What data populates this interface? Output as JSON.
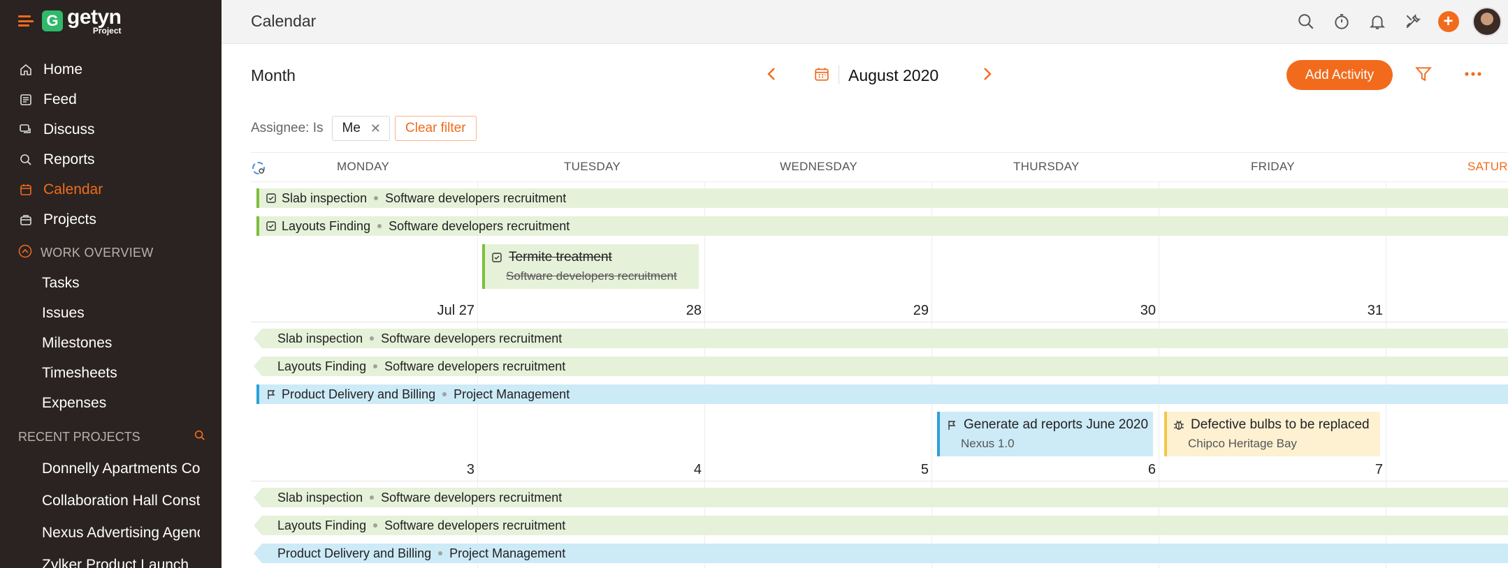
{
  "app": {
    "brand_name": "getyn",
    "brand_sub": "Project",
    "page_title": "Calendar"
  },
  "sidebar": {
    "nav": [
      {
        "label": "Home",
        "icon": "home-icon"
      },
      {
        "label": "Feed",
        "icon": "feed-icon"
      },
      {
        "label": "Discuss",
        "icon": "discuss-icon"
      },
      {
        "label": "Reports",
        "icon": "reports-icon"
      },
      {
        "label": "Calendar",
        "icon": "calendar-icon",
        "active": true
      },
      {
        "label": "Projects",
        "icon": "projects-icon"
      }
    ],
    "work_overview_label": "WORK OVERVIEW",
    "work_overview_items": [
      "Tasks",
      "Issues",
      "Milestones",
      "Timesheets",
      "Expenses"
    ],
    "recent_projects_label": "RECENT PROJECTS",
    "recent_projects": [
      "Donnelly Apartments Construction",
      "Collaboration Hall Construction",
      "Nexus Advertising Agency",
      "Zylker Product Launch"
    ]
  },
  "toolbar": {
    "view_label": "Month",
    "month_label": "August 2020",
    "add_activity_label": "Add Activity"
  },
  "filter": {
    "label": "Assignee: Is",
    "chip_value": "Me",
    "chip_remove": "✕",
    "clear_label": "Clear filter"
  },
  "calendar": {
    "weekdays": [
      "MONDAY",
      "TUESDAY",
      "WEDNESDAY",
      "THURSDAY",
      "FRIDAY",
      "SATURDAY"
    ],
    "week1": {
      "bars": [
        {
          "title": "Slab inspection",
          "project": "Software developers recruitment"
        },
        {
          "title": "Layouts Finding",
          "project": "Software developers recruitment"
        }
      ],
      "card": {
        "title": "Termite treatment",
        "project": "Software developers recruitment"
      },
      "days": [
        "Jul 27",
        "28",
        "29",
        "30",
        "31"
      ]
    },
    "week2": {
      "bars": [
        {
          "title": "Slab inspection",
          "project": "Software developers recruitment"
        },
        {
          "title": "Layouts Finding",
          "project": "Software developers recruitment"
        },
        {
          "title": "Product Delivery and Billing",
          "project": "Project Management"
        }
      ],
      "cards": [
        {
          "title": "Generate ad reports June 2020",
          "project": "Nexus 1.0"
        },
        {
          "title": "Defective bulbs to be replaced",
          "project": "Chipco Heritage Bay"
        }
      ],
      "days": [
        "3",
        "4",
        "5",
        "6",
        "7"
      ]
    },
    "week3": {
      "bars": [
        {
          "title": "Slab inspection",
          "project": "Software developers recruitment"
        },
        {
          "title": "Layouts Finding",
          "project": "Software developers recruitment"
        },
        {
          "title": "Product Delivery and Billing",
          "project": "Project Management"
        }
      ]
    }
  },
  "colors": {
    "accent": "#f26b1d",
    "sidebar_bg": "#2a2321",
    "task_green": "#e6f1d9",
    "milestone_blue": "#cdeaf7",
    "issue_yellow": "#fdf1d2"
  }
}
